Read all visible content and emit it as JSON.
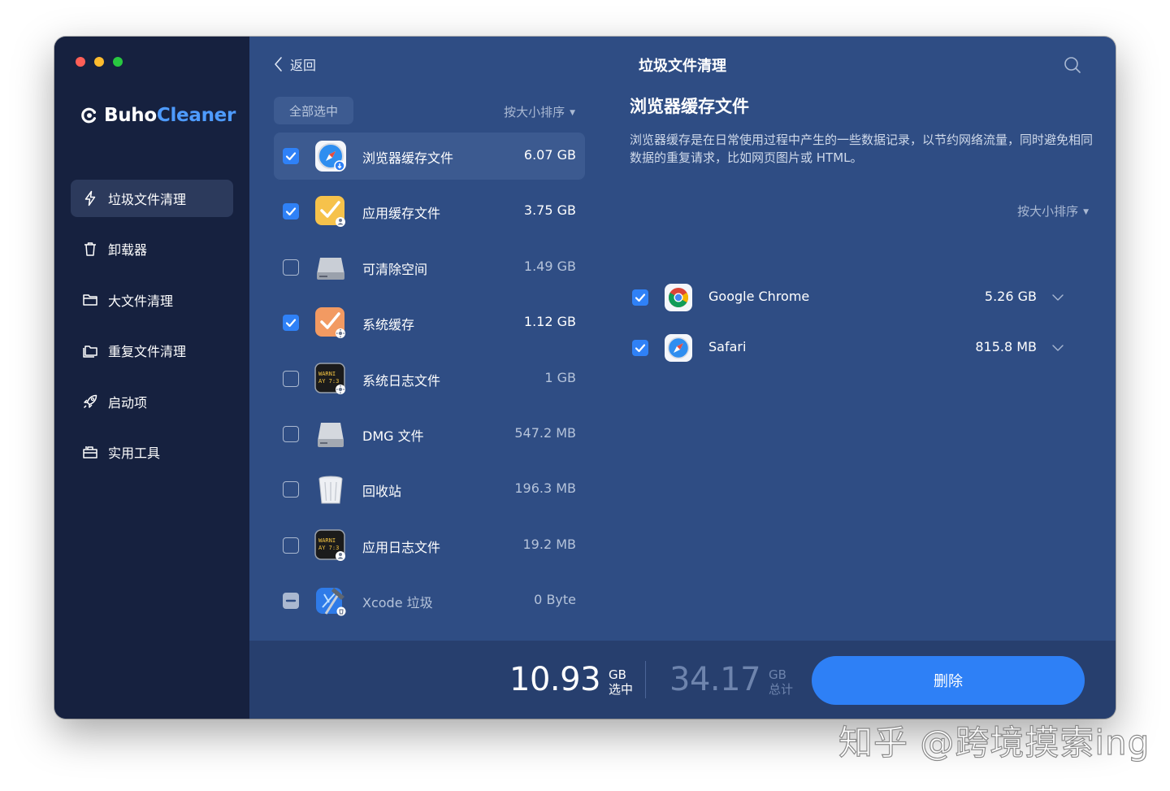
{
  "window": {
    "traffic_colors": [
      "#ff5f57",
      "#febc2e",
      "#28c840"
    ]
  },
  "sidebar": {
    "brand": {
      "prefix": "Buho",
      "suffix": "Cleaner"
    },
    "items": [
      {
        "label": "垃圾文件清理",
        "icon": "lightning-icon",
        "active": true
      },
      {
        "label": "卸载器",
        "icon": "trash-icon"
      },
      {
        "label": "大文件清理",
        "icon": "folder-icon"
      },
      {
        "label": "重复文件清理",
        "icon": "duplicate-folder-icon"
      },
      {
        "label": "启动项",
        "icon": "rocket-icon"
      },
      {
        "label": "实用工具",
        "icon": "toolbox-icon"
      }
    ]
  },
  "header": {
    "back_label": "返回",
    "title": "垃圾文件清理"
  },
  "list": {
    "select_all_label": "全部选中",
    "sort_label": "按大小排序",
    "items": [
      {
        "name": "浏览器缓存文件",
        "size": "6.07 GB",
        "checked": true,
        "icon": "safari-download-icon"
      },
      {
        "name": "应用缓存文件",
        "size": "3.75 GB",
        "checked": true,
        "icon": "app-cache-icon"
      },
      {
        "name": "可清除空间",
        "size": "1.49 GB",
        "checked": false,
        "icon": "disk-drive-icon"
      },
      {
        "name": "系统缓存",
        "size": "1.12 GB",
        "checked": true,
        "icon": "system-cache-icon"
      },
      {
        "name": "系统日志文件",
        "size": "1 GB",
        "checked": false,
        "icon": "console-log-icon"
      },
      {
        "name": "DMG 文件",
        "size": "547.2 MB",
        "checked": false,
        "icon": "disk-image-icon"
      },
      {
        "name": "回收站",
        "size": "196.3 MB",
        "checked": false,
        "icon": "trash-can-icon"
      },
      {
        "name": "应用日志文件",
        "size": "19.2 MB",
        "checked": false,
        "icon": "console-user-icon"
      },
      {
        "name": "Xcode 垃圾",
        "size": "0 Byte",
        "checked": "disabled",
        "icon": "xcode-icon"
      }
    ]
  },
  "detail": {
    "title": "浏览器缓存文件",
    "description": "浏览器缓存是在日常使用过程中产生的一些数据记录，以节约网络流量，同时避免相同数据的重复请求，比如网页图片或 HTML。",
    "sort_label": "按大小排序",
    "items": [
      {
        "name": "Google Chrome",
        "size": "5.26 GB",
        "checked": true,
        "icon": "chrome-icon"
      },
      {
        "name": "Safari",
        "size": "815.8 MB",
        "checked": true,
        "icon": "safari-icon"
      }
    ]
  },
  "footer": {
    "selected_value": "10.93",
    "selected_unit": "GB",
    "selected_caption": "选中",
    "total_value": "34.17",
    "total_unit": "GB",
    "total_caption": "总计",
    "delete_label": "删除"
  },
  "watermark": "知乎 @跨境摸索ing",
  "colors": {
    "accent": "#2e80f6",
    "sidebar_bg": "#16213f",
    "main_bg": "#2f4d84"
  }
}
